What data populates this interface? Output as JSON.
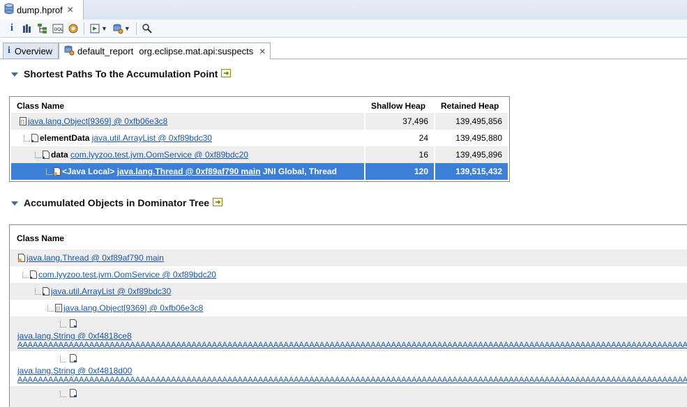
{
  "editor_tab": {
    "title": "dump.hprof",
    "close": "✕"
  },
  "report_tabs": [
    {
      "label": "Overview"
    },
    {
      "label": "default_report",
      "sub": "org.eclipse.mat.api:suspects",
      "close": "✕"
    }
  ],
  "section1": {
    "title": "Shortest Paths To the Accumulation Point",
    "columns": [
      "Class Name",
      "Shallow Heap",
      "Retained Heap"
    ],
    "rows": [
      {
        "prefix": "",
        "link": "java.lang.Object[9369] @ 0xfb06e3c8",
        "suffix": "",
        "shallow": "37,496",
        "retained": "139,495,856"
      },
      {
        "prefix": "elementData",
        "link": "java.util.ArrayList @ 0xf89bdc30",
        "suffix": "",
        "shallow": "24",
        "retained": "139,495,880"
      },
      {
        "prefix": "data",
        "link": "com.lyyzoo.test.jvm.OomService @ 0xf89bdc20",
        "suffix": "",
        "shallow": "16",
        "retained": "139,495,896"
      },
      {
        "prefix": "<Java Local>",
        "link": "java.lang.Thread @ 0xf89af790 main",
        "suffix": "JNI Global, Thread",
        "shallow": "120",
        "retained": "139,515,432"
      }
    ]
  },
  "section2": {
    "title": "Accumulated Objects in Dominator Tree",
    "columns": [
      "Class Name"
    ],
    "rows": [
      {
        "link": "java.lang.Thread @ 0xf89af790 main"
      },
      {
        "link": "com.lyyzoo.test.jvm.OomService @ 0xf89bdc20"
      },
      {
        "link": "java.util.ArrayList @ 0xf89bdc30"
      },
      {
        "link": "java.lang.Object[9369] @ 0xfb06e3c8"
      }
    ],
    "strings": [
      {
        "link": "java.lang.String @ 0xf4818ce8",
        "value": "AAAAAAAAAAAAAAAAAAAAAAAAAAAAAAAAAAAAAAAAAAAAAAAAAAAAAAAAAAAAAAAAAAAAAAAAAAAAAAAAAAAAAAAAAAAAAAAAAAAAAAAAAAAAAAAAAAAAAAAAAAAAAAAAAAAAAAAAAAAAAAAAA"
      },
      {
        "link": "java.lang.String @ 0xf4818d00",
        "value": "AAAAAAAAAAAAAAAAAAAAAAAAAAAAAAAAAAAAAAAAAAAAAAAAAAAAAAAAAAAAAAAAAAAAAAAAAAAAAAAAAAAAAAAAAAAAAAAAAAAAAAAAAAAAAAAAAAAAAAAAAAAAAAAAAAAAAAAAAAAAAAAAA"
      }
    ]
  },
  "colors": {
    "selection": "#3c7fd6",
    "link": "#1a55b3",
    "accent": "#3a6ea5"
  }
}
